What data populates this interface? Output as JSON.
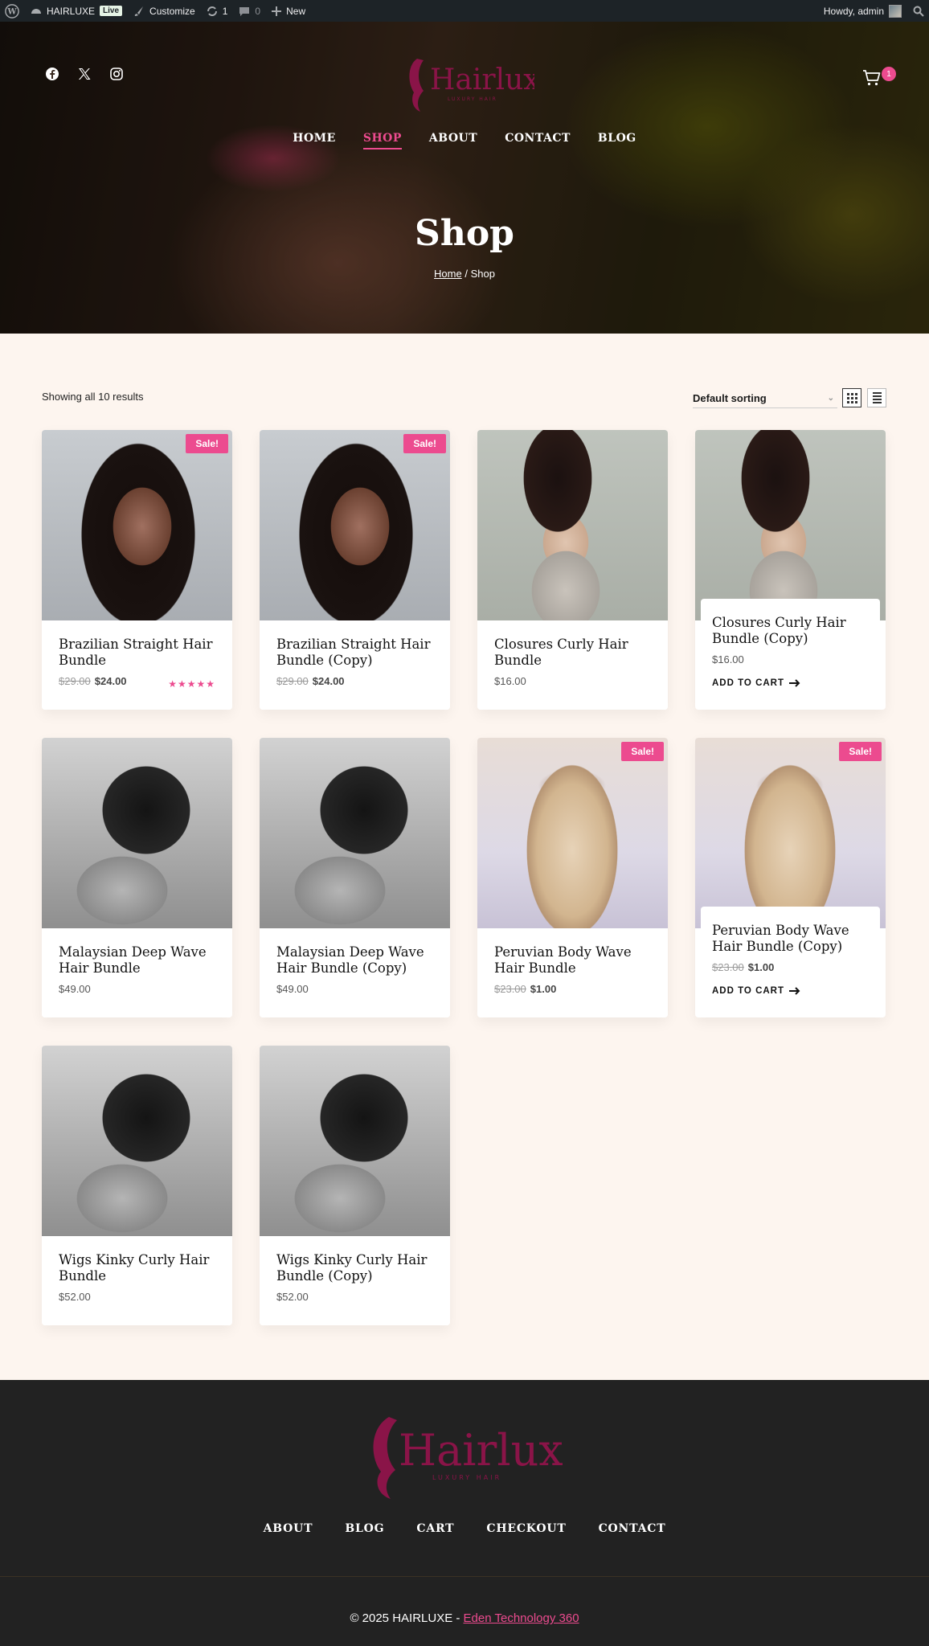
{
  "adminbar": {
    "site_name": "HAIRLUXE",
    "live_badge": "Live",
    "customize": "Customize",
    "updates_count": "1",
    "comments_count": "0",
    "new_label": "New",
    "howdy": "Howdy, admin"
  },
  "header": {
    "cart_count": "1",
    "nav": [
      {
        "label": "HOME"
      },
      {
        "label": "SHOP"
      },
      {
        "label": "ABOUT"
      },
      {
        "label": "CONTACT"
      },
      {
        "label": "BLOG"
      }
    ],
    "page_title": "Shop",
    "breadcrumb_home": "Home",
    "breadcrumb_sep": " / ",
    "breadcrumb_current": "Shop"
  },
  "logo": {
    "name": "Hairluxe",
    "tagline": "LUXURY HAIR",
    "color": "#8a1448"
  },
  "shop": {
    "result_count": "Showing all 10 results",
    "sorting": "Default sorting"
  },
  "products": [
    {
      "name": "Brazilian Straight Hair Bundle",
      "regular_price": "$29.00",
      "price": "$24.00",
      "sale_badge": "Sale!",
      "rating_stars": "★★★★★"
    },
    {
      "name": "Brazilian Straight Hair Bundle (Copy)",
      "regular_price": "$29.00",
      "price": "$24.00",
      "sale_badge": "Sale!"
    },
    {
      "name": "Closures Curly Hair Bundle",
      "price": "$16.00"
    },
    {
      "name": "Closures Curly Hair Bundle (Copy)",
      "price": "$16.00",
      "add_to_cart": "ADD TO CART"
    },
    {
      "name": "Malaysian Deep Wave Hair Bundle",
      "price": "$49.00"
    },
    {
      "name": "Malaysian Deep Wave Hair Bundle (Copy)",
      "price": "$49.00"
    },
    {
      "name": "Peruvian Body Wave Hair Bundle",
      "regular_price": "$23.00",
      "price": "$1.00",
      "sale_badge": "Sale!"
    },
    {
      "name": "Peruvian Body Wave Hair Bundle (Copy)",
      "regular_price": "$23.00",
      "price": "$1.00",
      "sale_badge": "Sale!",
      "add_to_cart": "ADD TO CART"
    },
    {
      "name": "Wigs Kinky Curly Hair Bundle",
      "price": "$52.00"
    },
    {
      "name": "Wigs Kinky Curly Hair Bundle (Copy)",
      "price": "$52.00"
    }
  ],
  "footer": {
    "nav": [
      {
        "label": "ABOUT"
      },
      {
        "label": "BLOG"
      },
      {
        "label": "CART"
      },
      {
        "label": "CHECKOUT"
      },
      {
        "label": "CONTACT"
      }
    ],
    "copyright": "© 2025 HAIRLUXE - ",
    "credit_link": "Eden Technology 360"
  },
  "colors": {
    "accent": "#ec4b8f",
    "page_bg": "#fdf5ef",
    "footer_bg": "#222222",
    "adminbar_bg": "#1d2327"
  }
}
